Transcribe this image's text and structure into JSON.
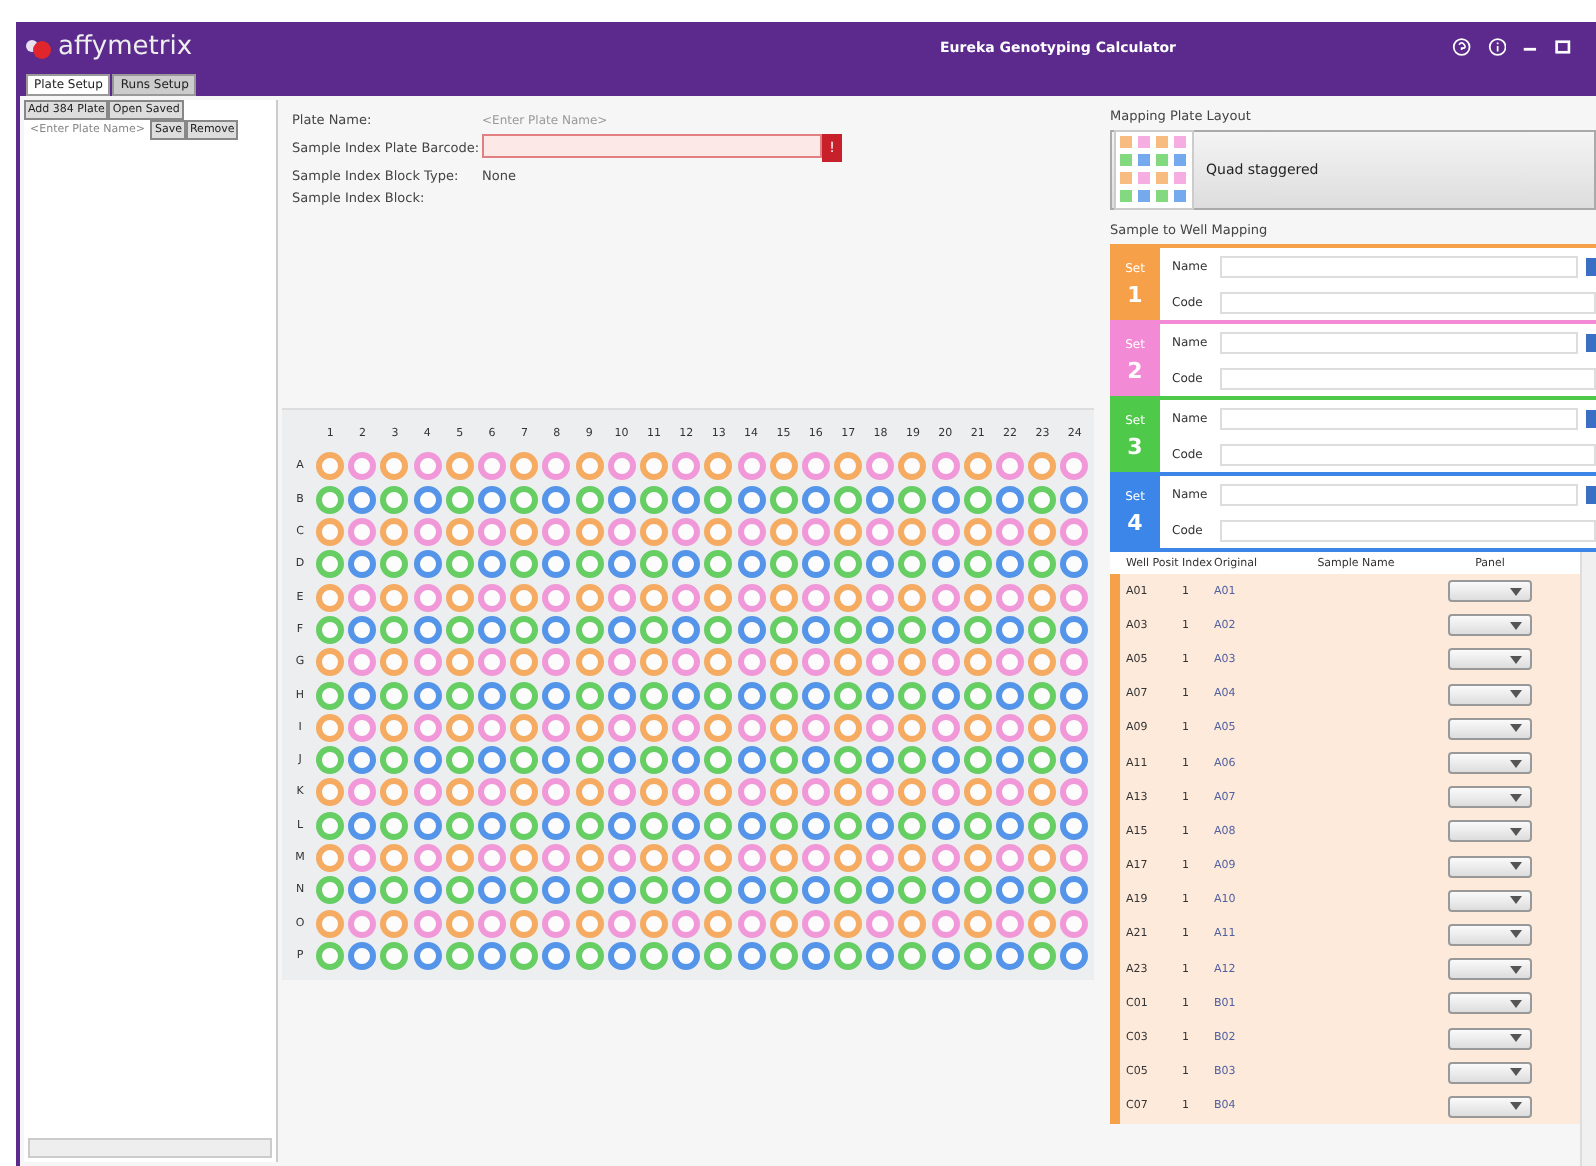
{
  "window": {
    "logo": "affymetrix",
    "title": "Eureka Genotyping Calculator"
  },
  "tabs": [
    {
      "label": "Plate Setup",
      "selected": true
    },
    {
      "label": "Runs Setup",
      "selected": false
    }
  ],
  "sidebar": {
    "buttons": [
      "Add 384 Plate",
      "Open Saved"
    ],
    "plate_name_placeholder": "<Enter Plate Name>",
    "actions": [
      "Save",
      "Remove"
    ]
  },
  "form": [
    {
      "label": "Plate Name:",
      "kind": "placeholder",
      "placeholder": "<Enter Plate Name>"
    },
    {
      "label": "Sample Index Plate Barcode:",
      "kind": "error-field",
      "error": "!"
    },
    {
      "label": "Sample Index Block Type:",
      "kind": "text",
      "value": "None"
    },
    {
      "label": "Sample Index Block:",
      "kind": "text"
    }
  ],
  "plate": {
    "kind": "quad-staggered",
    "columns": [
      "1",
      "2",
      "3",
      "4",
      "5",
      "6",
      "7",
      "8",
      "9",
      "10",
      "11",
      "12",
      "13",
      "14",
      "15",
      "16",
      "17",
      "18",
      "19",
      "20",
      "21",
      "22",
      "23",
      "24"
    ],
    "rows": [
      "A",
      "B",
      "C",
      "D",
      "E",
      "F",
      "G",
      "H",
      "I",
      "J",
      "K",
      "L",
      "M",
      "N",
      "O",
      "P"
    ]
  },
  "mapping_layout": {
    "label": "Mapping Plate Layout",
    "value": "Quad staggered"
  },
  "sets_label": "Sample to Well Mapping",
  "sets": [
    {
      "title": "Set",
      "number": "1",
      "color": "#f7a04a",
      "name_label": "Name",
      "code_label": "Code"
    },
    {
      "title": "Set",
      "number": "2",
      "color": "#f28ad6",
      "name_label": "Name",
      "code_label": "Code"
    },
    {
      "title": "Set",
      "number": "3",
      "color": "#4fc94a",
      "name_label": "Name",
      "code_label": "Code"
    },
    {
      "title": "Set",
      "number": "4",
      "color": "#3b86e8",
      "name_label": "Name",
      "code_label": "Code"
    }
  ],
  "table": {
    "columns": [
      "Well Posit",
      "Index",
      "Original",
      "Sample Name",
      "Panel"
    ],
    "rows": [
      {
        "well": "A01",
        "index": "1",
        "original": "A01",
        "color": "#f7a04a"
      },
      {
        "well": "A03",
        "index": "1",
        "original": "A02",
        "color": "#f7a04a"
      },
      {
        "well": "A05",
        "index": "1",
        "original": "A03",
        "color": "#f7a04a"
      },
      {
        "well": "A07",
        "index": "1",
        "original": "A04",
        "color": "#f7a04a"
      },
      {
        "well": "A09",
        "index": "1",
        "original": "A05",
        "color": "#f7a04a"
      },
      {
        "well": "A11",
        "index": "1",
        "original": "A06",
        "color": "#f7a04a"
      },
      {
        "well": "A13",
        "index": "1",
        "original": "A07",
        "color": "#f7a04a"
      },
      {
        "well": "A15",
        "index": "1",
        "original": "A08",
        "color": "#f7a04a"
      },
      {
        "well": "A17",
        "index": "1",
        "original": "A09",
        "color": "#f7a04a"
      },
      {
        "well": "A19",
        "index": "1",
        "original": "A10",
        "color": "#f7a04a"
      },
      {
        "well": "A21",
        "index": "1",
        "original": "A11",
        "color": "#f7a04a"
      },
      {
        "well": "A23",
        "index": "1",
        "original": "A12",
        "color": "#f7a04a"
      },
      {
        "well": "C01",
        "index": "1",
        "original": "B01",
        "color": "#f7a04a"
      },
      {
        "well": "C03",
        "index": "1",
        "original": "B02",
        "color": "#f7a04a"
      },
      {
        "well": "C05",
        "index": "1",
        "original": "B03",
        "color": "#f7a04a"
      },
      {
        "well": "C07",
        "index": "1",
        "original": "B04",
        "color": "#f7a04a"
      }
    ]
  }
}
